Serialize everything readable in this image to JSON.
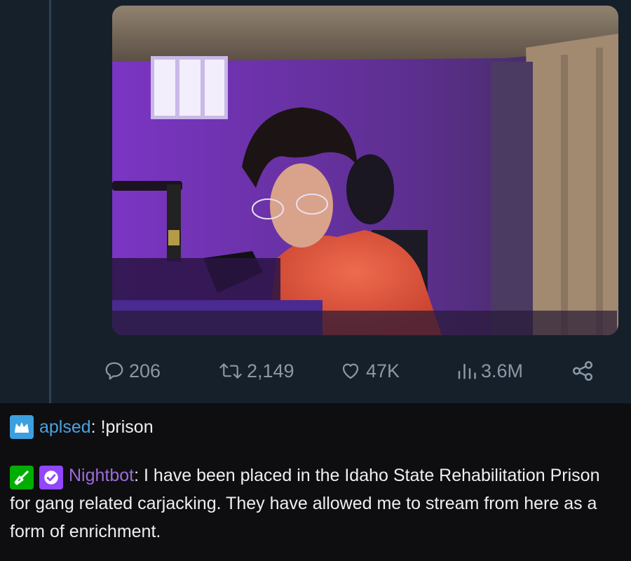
{
  "tweet": {
    "stats": {
      "replies": "206",
      "retweets": "2,149",
      "likes": "47K",
      "views": "3.6M"
    },
    "icons": {
      "replies": "reply-bubble-icon",
      "retweets": "retweet-icon",
      "likes": "heart-icon",
      "views": "views-bar-chart-icon",
      "share": "share-nodes-icon"
    }
  },
  "chat": {
    "messages": [
      {
        "username": "aplsed",
        "separator": ":",
        "text": " !prison",
        "name_color": "#4aa3e2",
        "badges": [
          "crown-icon"
        ]
      },
      {
        "username": "Nightbot",
        "separator": ":",
        "text": " I have been placed in the Idaho State Rehabilitation Prison for gang related carjacking. They have allowed me to stream from here as a form of enrichment.",
        "name_color": "#9e6bd8",
        "badges": [
          "moderator-sword-icon",
          "verified-check-icon"
        ]
      }
    ]
  },
  "colors": {
    "tweet_bg": "#15202b",
    "chat_bg": "#0e0e10",
    "muted_text": "#8b98a5"
  }
}
